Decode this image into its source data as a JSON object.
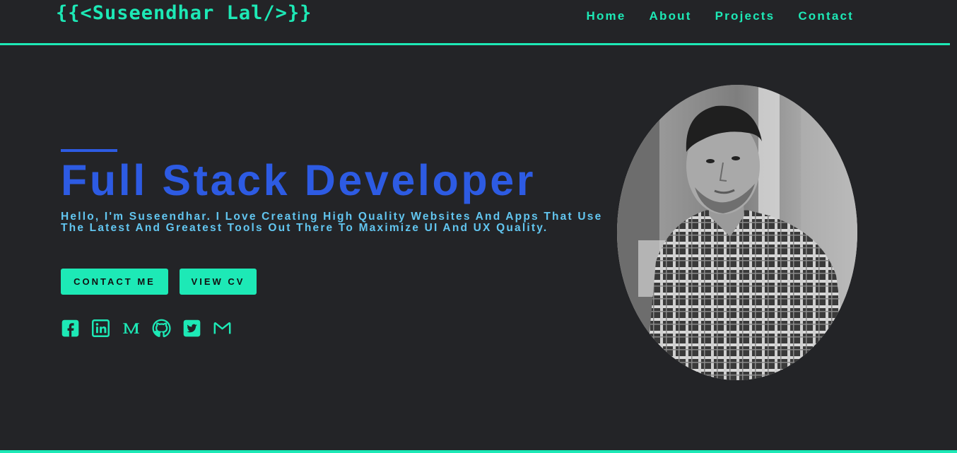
{
  "brand": {
    "logo_text": "{{<Suseendhar Lal/>}}"
  },
  "nav": {
    "items": [
      {
        "label": "Home"
      },
      {
        "label": "About"
      },
      {
        "label": "Projects"
      },
      {
        "label": "Contact"
      }
    ]
  },
  "hero": {
    "title": "Full Stack Developer",
    "intro": "Hello, I'm Suseendhar. I Love Creating High Quality Websites And Apps That Use The Latest And Greatest Tools Out There To Maximize UI And UX Quality.",
    "buttons": {
      "contact_label": "CONTACT ME",
      "cv_label": "VIEW CV"
    },
    "socials": [
      {
        "icon": "facebook-icon"
      },
      {
        "icon": "linkedin-icon"
      },
      {
        "icon": "medium-icon"
      },
      {
        "icon": "github-icon"
      },
      {
        "icon": "twitter-icon"
      },
      {
        "icon": "gmail-icon"
      }
    ],
    "portrait": {
      "icon": "profile-photo"
    }
  },
  "colors": {
    "background": "#232427",
    "accent": "#1de9b6",
    "title": "#2d5be3",
    "intro": "#62c6f0"
  }
}
